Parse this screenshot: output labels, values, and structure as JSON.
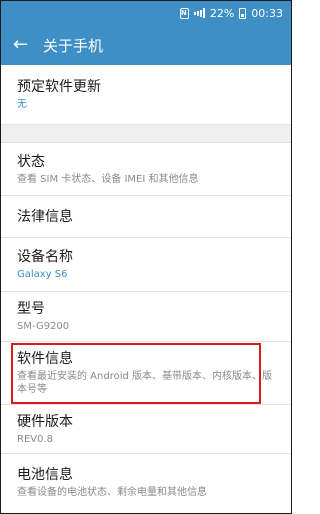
{
  "status_bar": {
    "nfc_icon": "nfc-icon",
    "signal_icon": "signal-icon",
    "battery_percent": "22%",
    "battery_icon": "battery-icon",
    "time": "00:33"
  },
  "app_bar": {
    "back_icon": "back-arrow-icon",
    "title": "关于手机"
  },
  "items": [
    {
      "title": "预定软件更新",
      "subtitle": "无",
      "subtitle_accent": true
    },
    {
      "title": "状态",
      "subtitle": "查看 SIM 卡状态、设备 IMEI 和其他信息"
    },
    {
      "title": "法律信息",
      "subtitle": ""
    },
    {
      "title": "设备名称",
      "subtitle": "Galaxy S6",
      "subtitle_accent": true
    },
    {
      "title": "型号",
      "subtitle": "SM-G9200"
    },
    {
      "title": "软件信息",
      "subtitle": "查看最近安装的 Android 版本、基带版本、内核版本、版本号等",
      "highlighted": true
    },
    {
      "title": "硬件版本",
      "subtitle": "REV0.8"
    },
    {
      "title": "电池信息",
      "subtitle": "查看设备的电池状态、剩余电量和其他信息"
    }
  ],
  "colors": {
    "primary": "#3d8fc6",
    "highlight_border": "#d81a1a"
  }
}
